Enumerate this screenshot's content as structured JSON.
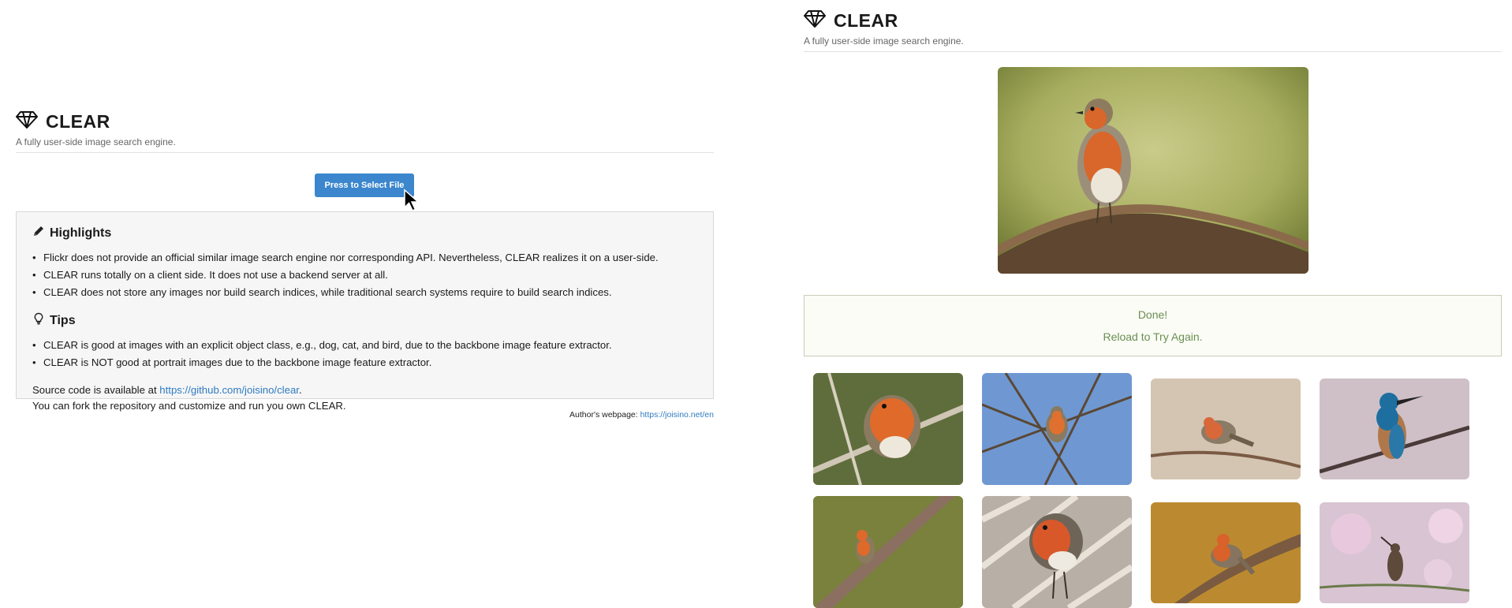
{
  "left": {
    "brand": {
      "title": "CLEAR",
      "subtitle": "A fully user-side image search engine."
    },
    "select_button": "Press to Select File",
    "highlights": {
      "heading": "Highlights",
      "items": [
        "Flickr does not provide an official similar image search engine nor corresponding API. Nevertheless, CLEAR realizes it on a user-side.",
        "CLEAR runs totally on a client side. It does not use a backend server at all.",
        "CLEAR does not store any images nor build search indices, while traditional search systems require to build search indices."
      ]
    },
    "tips": {
      "heading": "Tips",
      "items": [
        "CLEAR is good at images with an explicit object class, e.g., dog, cat, and bird, due to the backbone image feature extractor.",
        "CLEAR is NOT good at portrait images due to the backbone image feature extractor."
      ]
    },
    "source": {
      "prefix": "Source code is available at ",
      "link": "https://github.com/joisino/clear",
      "suffix": ".",
      "line2": "You can fork the repository and customize and run you own CLEAR."
    },
    "author": {
      "label": "Author's webpage: ",
      "link": "https://joisino.net/en"
    }
  },
  "right": {
    "brand": {
      "title": "CLEAR",
      "subtitle": "A fully user-side image search engine."
    },
    "status": {
      "line1": "Done!",
      "line2": "Reload to Try Again."
    },
    "query_image": "robin-on-branch-photo",
    "results": [
      "robin-closeup-photo",
      "robin-in-tree-blue-sky-photo",
      "robin-on-twig-photo",
      "kingfisher-on-branch-photo",
      "robin-on-mossy-branch-photo",
      "robin-on-pavement-photo",
      "robin-on-branch-orange-bg-photo",
      "sunbird-on-flowers-photo"
    ]
  },
  "colors": {
    "accent": "#3b86cd",
    "status_text": "#6a8f52",
    "link": "#2f7bc0"
  }
}
